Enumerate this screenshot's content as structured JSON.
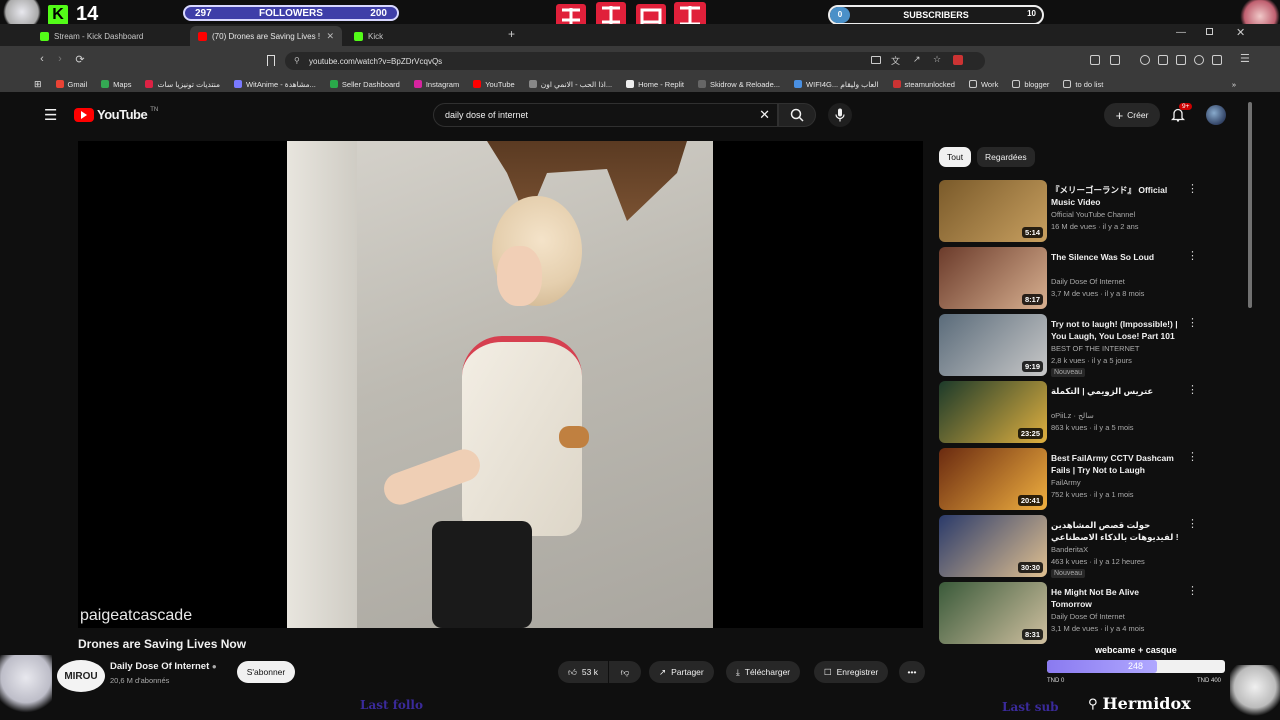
{
  "overlay": {
    "kick_count": "14",
    "followers": {
      "left": "297",
      "label": "FOLLOWERS",
      "right": "200"
    },
    "subscribers": {
      "left": "0",
      "label": "SUBSCRIBERS",
      "right": "10"
    },
    "webcam": {
      "label": "webcame + casque",
      "value": "248",
      "min": "TND 0",
      "max": "TND 400",
      "fraction": 0.62
    },
    "last_follow": "Last follo",
    "last_sub": "Last sub",
    "streamer": "Hermidox",
    "colors": {
      "follow_bar": "#3e3ea8",
      "kick_green": "#53fc18",
      "jjk_red": "#e0203a"
    }
  },
  "browser": {
    "tabs": [
      {
        "label": "Stream - Kick Dashboard",
        "fav_color": "#53fc18"
      },
      {
        "label": "(70) Drones are Saving Lives !",
        "fav_color": "#ff0000"
      },
      {
        "label": "Kick",
        "fav_color": "#53fc18"
      }
    ],
    "url": "youtube.com/watch?v=BpZDrVcqvQs",
    "bookmarks": [
      {
        "label": "Gmail",
        "color": "#ea4335"
      },
      {
        "label": "Maps",
        "color": "#34a853"
      },
      {
        "label": "منتديات تونيزيا سات",
        "color": "#d24"
      },
      {
        "label": "WitAnime - مشاهدة...",
        "color": "#7a7aff"
      },
      {
        "label": "Seller Dashboard",
        "color": "#2aa84a"
      },
      {
        "label": "Instagram",
        "color": "#d6249f"
      },
      {
        "label": "YouTube",
        "color": "#ff0000"
      },
      {
        "label": "اذا الحب - الانمي اون...",
        "color": "#888"
      },
      {
        "label": "Home - Replit",
        "color": "#222"
      },
      {
        "label": "Skidrow & Reloade...",
        "color": "#444"
      },
      {
        "label": "WIFI4G... العاب وليقام",
        "color": "#4a90e2"
      },
      {
        "label": "steamunlocked",
        "color": "#c33"
      },
      {
        "label": "Work",
        "color": "folder"
      },
      {
        "label": "blogger",
        "color": "folder"
      },
      {
        "label": "to do list",
        "color": "folder"
      }
    ]
  },
  "youtube": {
    "logo": "YouTube",
    "logo_sup": "TN",
    "search_value": "daily dose of internet",
    "create_label": "Créer",
    "notif_count": "9+",
    "watermark": "paigeatcascade",
    "video_title": "Drones are Saving Lives Now",
    "channel": {
      "avatar_text": "MIROU",
      "name": "Daily Dose Of Internet",
      "subs": "20,6 M d'abonnés"
    },
    "subscribe_label": "S'abonner",
    "likes": "53 k",
    "share_label": "Partager",
    "download_label": "Télécharger",
    "save_label": "Enregistrer",
    "chips": [
      "Tout",
      "Regardées"
    ],
    "recommendations": [
      {
        "title": "『メリーゴーランド』 Official Music Video",
        "channel": "Official YouTube Channel",
        "meta": "16 M de vues · il y a 2 ans",
        "duration": "5:14",
        "c1": "#7a5a2a",
        "c2": "#c8a060",
        "badge": ""
      },
      {
        "title": "The Silence Was So Loud",
        "channel": "Daily Dose Of Internet",
        "meta": "3,7 M de vues · il y a 8 mois",
        "duration": "8:17",
        "c1": "#6b3b2b",
        "c2": "#d8b090",
        "badge": ""
      },
      {
        "title": "Try not to laugh! (Impossible!) | You Laugh, You Lose! Part 101",
        "channel": "BEST OF THE INTERNET",
        "meta": "2,8 k vues · il y a 5 jours",
        "duration": "9:19",
        "c1": "#5a6b7a",
        "c2": "#c8c8c8",
        "badge": "Nouveau"
      },
      {
        "title": "عتريس الزويمي | التكملة",
        "channel": "oPiiLz · سالح",
        "meta": "863 k vues · il y a 5 mois",
        "duration": "23:25",
        "c1": "#1c3a2a",
        "c2": "#e0b040",
        "badge": ""
      },
      {
        "title": "Best FailArmy CCTV Dashcam Fails | Try Not to Laugh",
        "channel": "FailArmy",
        "meta": "752 k vues · il y a 1 mois",
        "duration": "20:41",
        "c1": "#6a2a10",
        "c2": "#f0b040",
        "badge": ""
      },
      {
        "title": "حولت قصص المشاهدين لفيديوهات بالذكاء الاصطناعي !",
        "channel": "BanderitaX",
        "meta": "463 k vues · il y a 12 heures",
        "duration": "30:30",
        "c1": "#2a3a6a",
        "c2": "#e0c090",
        "badge": "Nouveau"
      },
      {
        "title": "He Might Not Be Alive Tomorrow",
        "channel": "Daily Dose Of Internet",
        "meta": "3,1 M de vues · il y a 4 mois",
        "duration": "8:31",
        "c1": "#3a5a3a",
        "c2": "#d0c0a0",
        "badge": ""
      }
    ]
  }
}
